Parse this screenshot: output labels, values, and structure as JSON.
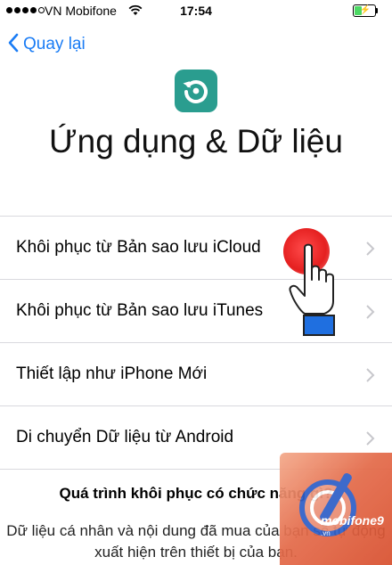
{
  "status_bar": {
    "carrier": "VN Mobifone",
    "time": "17:54",
    "battery_level": 0.35,
    "signal_bars_filled": 4,
    "signal_bars_total": 5
  },
  "nav": {
    "back_label": "Quay lại"
  },
  "header": {
    "title": "Ứng dụng & Dữ liệu"
  },
  "options": [
    {
      "label": "Khôi phục từ Bản sao lưu iCloud"
    },
    {
      "label": "Khôi phục từ Bản sao lưu iTunes"
    },
    {
      "label": "Thiết lập như iPhone Mới"
    },
    {
      "label": "Di chuyển Dữ liệu từ Android"
    }
  ],
  "info": {
    "title": "Quá trình khôi phục có chức năng gì?",
    "body": "Dữ liệu cá nhân và nội dung đã mua của bạn sẽ tự động xuất hiện trên thiết bị của bạn."
  },
  "watermark": {
    "brand": "mobifone9",
    "suffix": ".vn"
  },
  "colors": {
    "accent": "#1a7cf5",
    "icon_bg": "#2a9d8f",
    "tap": "#e52020",
    "battery": "#4cd964"
  }
}
